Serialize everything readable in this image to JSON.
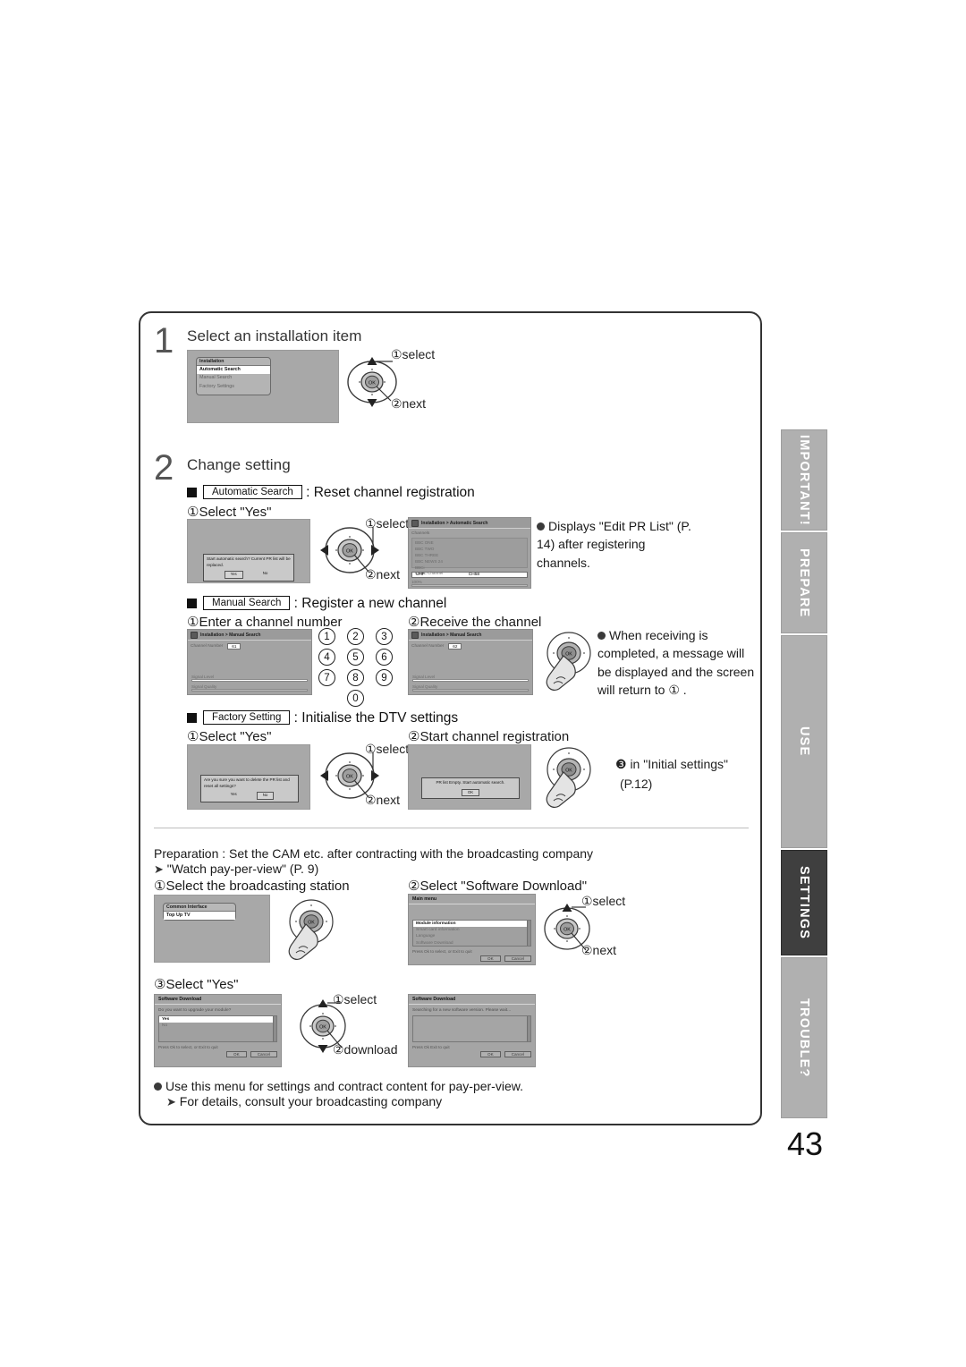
{
  "page": {
    "number": "43"
  },
  "side_tabs": [
    {
      "label": "IMPORTANT!",
      "active": false
    },
    {
      "label": "PREPARE",
      "active": false
    },
    {
      "label": "USE",
      "active": false
    },
    {
      "label": "SETTINGS",
      "active": true
    },
    {
      "label": "TROUBLE?",
      "active": false
    }
  ],
  "step1": {
    "number": "1",
    "title": "Select an installation item",
    "screen": {
      "menu_title": "Installation",
      "items": [
        "Automatic Search",
        "Manual Search",
        "Factory Settings"
      ],
      "selected_index": 0
    },
    "dpad_labels": {
      "select": "①select",
      "next": "②next"
    }
  },
  "step2": {
    "number": "2",
    "title": "Change setting",
    "auto": {
      "box_label": "Automatic Search",
      "heading": ": Reset channel registration",
      "sub": "①Select \"Yes\"",
      "dialog": {
        "text": "Start automatic search? Current PR list will be replaced.",
        "yes": "Yes",
        "no": "No"
      },
      "dpad_labels": {
        "select": "①select",
        "next": "②next"
      },
      "osd": {
        "title": "Installation > Automatic Search",
        "list_label": "Channels",
        "channels": [
          "BBC ONE",
          "BBC TWO",
          "BBC THREE",
          "BBC NEWS 24",
          "BBCi",
          "CBBC Channel"
        ],
        "band": "UHF",
        "channel": "CH58",
        "percent": "100%"
      },
      "note": "Displays \"Edit PR List\" (P. 14) after registering channels."
    },
    "manual": {
      "box_label": "Manual Search",
      "heading": ": Register a new channel",
      "sub1": "①Enter a channel number",
      "sub2": "②Receive the channel",
      "osd1": {
        "title": "Installation > Manual Search",
        "field_label": "Channel Number",
        "field_value": "61",
        "signal_level": "Signal Level",
        "signal_quality": "Signal Quality"
      },
      "osd2": {
        "title": "Installation > Manual Search",
        "field_label": "Channel Number",
        "field_value": "62",
        "signal_level": "Signal Level",
        "signal_quality": "Signal Quality"
      },
      "keypad": [
        "1",
        "2",
        "3",
        "4",
        "5",
        "6",
        "7",
        "8",
        "9",
        "0"
      ],
      "note": "When receiving is completed, a message will be displayed and the screen will return to ① ."
    },
    "factory": {
      "box_label": "Factory Setting",
      "heading": ": Initialise the DTV settings",
      "sub1": "①Select \"Yes\"",
      "sub2": "②Start channel registration",
      "dialog1": {
        "text": "Are you sure you want to delete the PR list and reset all settings?",
        "yes": "Yes",
        "no": "No"
      },
      "dialog2": {
        "text": "PR list Empty. Start automatic search.",
        "ok": "OK"
      },
      "dpad_labels": {
        "select": "①select",
        "next": "②next"
      },
      "note_line1": "❸ in \"Initial settings\"",
      "note_line2": "(P.12)"
    }
  },
  "section3": {
    "prep_line1": "Preparation : Set the CAM etc. after contracting with the broadcasting company",
    "prep_line2": "\"Watch pay-per-view\" (P. 9)",
    "sub1": "①Select the broadcasting station",
    "sub2": "②Select \"Software Download\"",
    "sub3": "③Select \"Yes\"",
    "ci_screen": {
      "title": "Common Interface",
      "value": "Top Up TV"
    },
    "main_menu": {
      "title": "Main menu",
      "items": [
        "Module information",
        "Smart card information",
        "Language",
        "Software Download"
      ],
      "selected_index": 0,
      "footer": "Press Ok to select, or Exit to quit",
      "ok": "OK",
      "cancel": "Cancel"
    },
    "dpad_labels_menu": {
      "select": "①select",
      "next": "②next"
    },
    "sw_dialog1": {
      "title": "Software Download",
      "prompt": "Do you want to upgrade your module?",
      "options": [
        "Yes",
        "No"
      ],
      "selected_index": 0,
      "footer": "Press Ok to select, or Exit to quit",
      "ok": "OK",
      "cancel": "Cancel"
    },
    "sw_dialog2": {
      "title": "Software Download",
      "prompt": "Searching for a new software version. Please wait...",
      "footer": "Press Ok Exit to quit",
      "ok": "OK",
      "cancel": "Cancel"
    },
    "dpad_labels_dl": {
      "select": "①select",
      "download": "②download"
    },
    "foot_line1": "Use this menu for settings and contract content for pay-per-view.",
    "foot_line2": "For details, consult your broadcasting company"
  }
}
